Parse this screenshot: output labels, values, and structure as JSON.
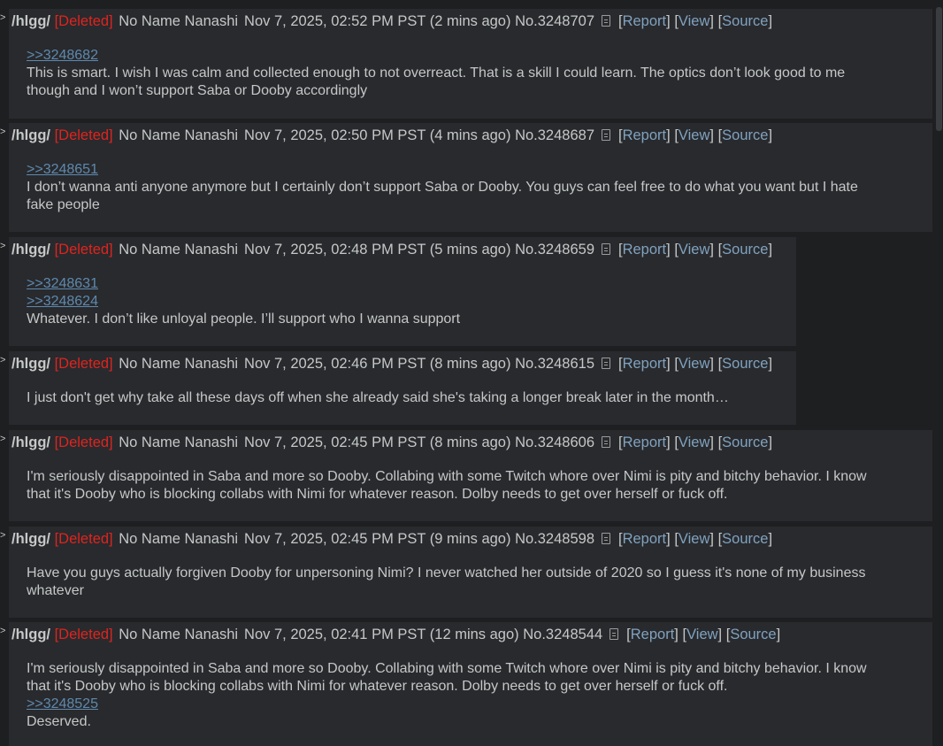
{
  "posts": [
    {
      "board": "/hlgg/",
      "deleted": "[Deleted]",
      "name": "No Name Nanashi",
      "date": "Nov 7, 2025, 02:52 PM PST (2 mins ago)",
      "no": "No.3248707",
      "report": "Report",
      "view": "View",
      "source": "Source",
      "quotes": [
        ">>3248682"
      ],
      "lines": [
        "This is smart. I wish I was calm and collected enough to not overreact. That is a skill I could learn. The optics don’t look good to me",
        "though and I won’t support Saba or Dooby accordingly"
      ]
    },
    {
      "board": "/hlgg/",
      "deleted": "[Deleted]",
      "name": "No Name Nanashi",
      "date": "Nov 7, 2025, 02:50 PM PST (4 mins ago)",
      "no": "No.3248687",
      "report": "Report",
      "view": "View",
      "source": "Source",
      "quotes": [
        ">>3248651"
      ],
      "lines": [
        "I don’t wanna anti anyone anymore but I certainly don’t support Saba or Dooby. You guys can feel free to do what you want but I hate",
        "fake people"
      ]
    },
    {
      "board": "/hlgg/",
      "deleted": "[Deleted]",
      "name": "No Name Nanashi",
      "date": "Nov 7, 2025, 02:48 PM PST (5 mins ago)",
      "no": "No.3248659",
      "report": "Report",
      "view": "View",
      "source": "Source",
      "quotes": [
        ">>3248631",
        ">>3248624"
      ],
      "lines": [
        "Whatever. I don’t like unloyal people. I’ll support who I wanna support"
      ]
    },
    {
      "board": "/hlgg/",
      "deleted": "[Deleted]",
      "name": "No Name Nanashi",
      "date": "Nov 7, 2025, 02:46 PM PST (8 mins ago)",
      "no": "No.3248615",
      "report": "Report",
      "view": "View",
      "source": "Source",
      "quotes": [],
      "lines": [
        "I just don't get why take all these days off when she already said she's taking a longer break later in the month…"
      ]
    },
    {
      "board": "/hlgg/",
      "deleted": "[Deleted]",
      "name": "No Name Nanashi",
      "date": "Nov 7, 2025, 02:45 PM PST (8 mins ago)",
      "no": "No.3248606",
      "report": "Report",
      "view": "View",
      "source": "Source",
      "quotes": [],
      "lines": [
        "I'm seriously disappointed in Saba and more so Dooby. Collabing with some Twitch whore over Nimi is pity and bitchy behavior. I know",
        "that it's Dooby who is blocking collabs with Nimi for whatever reason. Dolby needs to get over herself or fuck off."
      ]
    },
    {
      "board": "/hlgg/",
      "deleted": "[Deleted]",
      "name": "No Name Nanashi",
      "date": "Nov 7, 2025, 02:45 PM PST (9 mins ago)",
      "no": "No.3248598",
      "report": "Report",
      "view": "View",
      "source": "Source",
      "quotes": [],
      "lines": [
        "Have you guys actually forgiven Dooby for unpersoning Nimi? I never watched her outside of 2020 so I guess it's none of my business",
        "whatever"
      ]
    },
    {
      "board": "/hlgg/",
      "deleted": "[Deleted]",
      "name": "No Name Nanashi",
      "date": "Nov 7, 2025, 02:41 PM PST (12 mins ago)",
      "no": "No.3248544",
      "report": "Report",
      "view": "View",
      "source": "Source",
      "quotes": [],
      "lines": [
        "I'm seriously disappointed in Saba and more so Dooby. Collabing with some Twitch whore over Nimi is pity and bitchy behavior. I know",
        "that it's Dooby who is blocking collabs with Nimi for whatever reason. Dolby needs to get over herself or fuck off."
      ],
      "after_quotes": [
        ">>3248525"
      ],
      "after_lines": [
        "Deserved."
      ]
    }
  ]
}
